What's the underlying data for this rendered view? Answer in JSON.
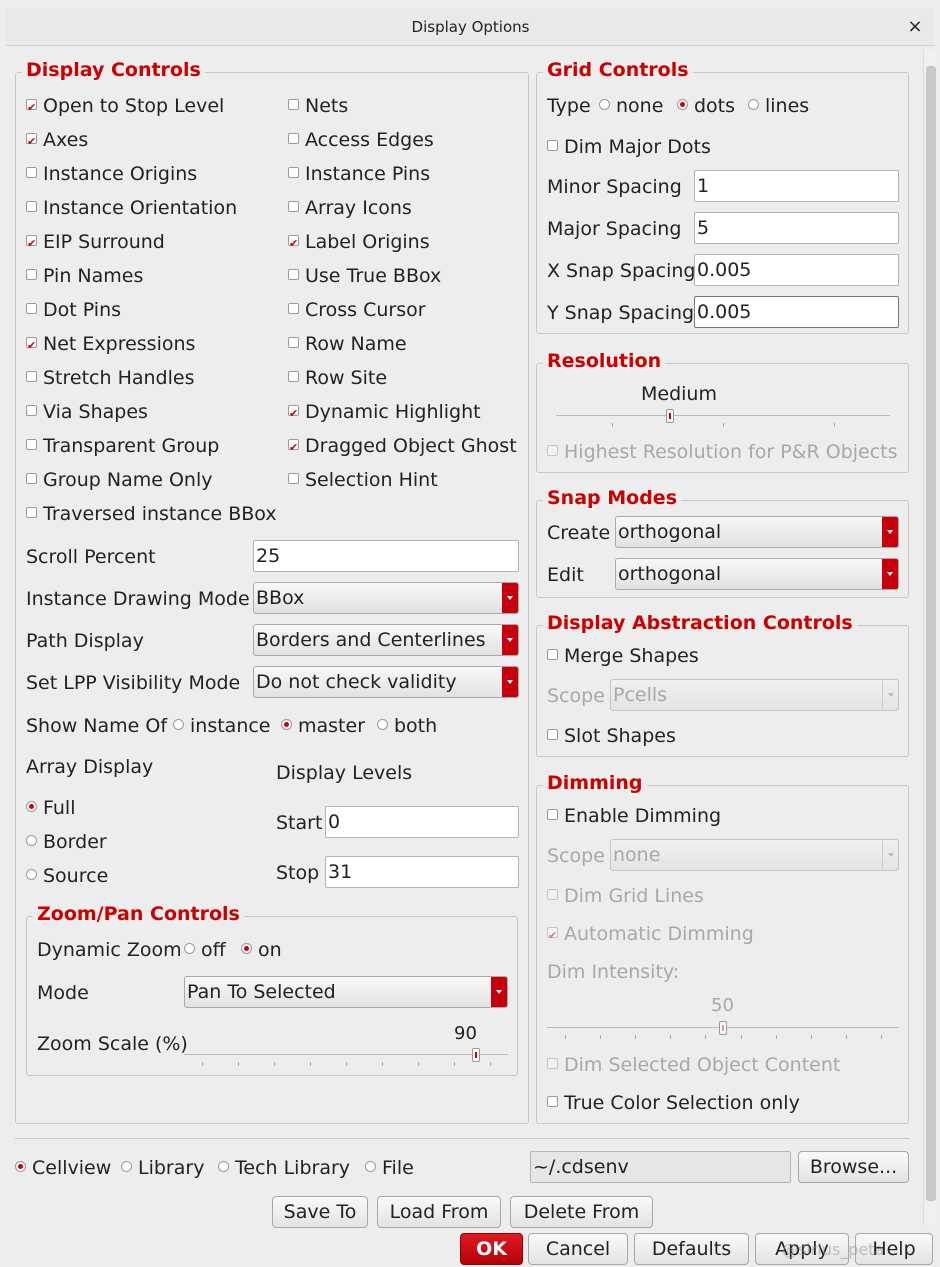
{
  "window": {
    "title": "Display Options",
    "close": "×"
  },
  "display_controls": {
    "title": "Display Controls",
    "left": [
      {
        "label": "Open to Stop Level",
        "checked": true
      },
      {
        "label": "Axes",
        "checked": true
      },
      {
        "label": "Instance Origins",
        "checked": false
      },
      {
        "label": "Instance Orientation",
        "checked": false
      },
      {
        "label": "EIP Surround",
        "checked": true
      },
      {
        "label": "Pin Names",
        "checked": false
      },
      {
        "label": "Dot Pins",
        "checked": false
      },
      {
        "label": "Net Expressions",
        "checked": true
      },
      {
        "label": "Stretch Handles",
        "checked": false
      },
      {
        "label": "Via Shapes",
        "checked": false
      },
      {
        "label": "Transparent Group",
        "checked": false
      },
      {
        "label": "Group Name Only",
        "checked": false
      },
      {
        "label": "Traversed instance BBox",
        "checked": false
      }
    ],
    "right": [
      {
        "label": "Nets",
        "checked": false
      },
      {
        "label": "Access Edges",
        "checked": false
      },
      {
        "label": "Instance Pins",
        "checked": false
      },
      {
        "label": "Array Icons",
        "checked": false
      },
      {
        "label": "Label Origins",
        "checked": true
      },
      {
        "label": "Use True BBox",
        "checked": false
      },
      {
        "label": "Cross Cursor",
        "checked": false
      },
      {
        "label": "Row Name",
        "checked": false
      },
      {
        "label": "Row Site",
        "checked": false
      },
      {
        "label": "Dynamic Highlight",
        "checked": true
      },
      {
        "label": "Dragged Object Ghost",
        "checked": true
      },
      {
        "label": "Selection Hint",
        "checked": false
      }
    ],
    "scroll_percent": {
      "label": "Scroll Percent",
      "value": "25"
    },
    "instance_drawing_mode": {
      "label": "Instance Drawing Mode",
      "value": "BBox"
    },
    "path_display": {
      "label": "Path Display",
      "value": "Borders and Centerlines"
    },
    "lpp_visibility": {
      "label": "Set LPP Visibility Mode",
      "value": "Do not check validity"
    },
    "show_name_of": {
      "label": "Show Name Of",
      "options": [
        "instance",
        "master",
        "both"
      ],
      "selected": "master"
    },
    "array_display": {
      "label": "Array Display",
      "options": [
        "Full",
        "Border",
        "Source"
      ],
      "selected": "Full"
    },
    "display_levels": {
      "label": "Display Levels",
      "start_label": "Start",
      "start": "0",
      "stop_label": "Stop",
      "stop": "31"
    },
    "zoom_pan": {
      "title": "Zoom/Pan Controls",
      "dynamic_zoom_label": "Dynamic Zoom",
      "dynamic_zoom_options": [
        "off",
        "on"
      ],
      "dynamic_zoom_selected": "on",
      "mode_label": "Mode",
      "mode_value": "Pan To Selected",
      "zoom_scale_label": "Zoom Scale (%)",
      "zoom_scale_value": "90",
      "zoom_scale_fraction": 0.9
    }
  },
  "grid_controls": {
    "title": "Grid Controls",
    "type_label": "Type",
    "type_options": [
      "none",
      "dots",
      "lines"
    ],
    "type_selected": "dots",
    "dim_major_dots": {
      "label": "Dim Major Dots",
      "checked": false
    },
    "minor_spacing": {
      "label": "Minor Spacing",
      "value": "1"
    },
    "major_spacing": {
      "label": "Major Spacing",
      "value": "5"
    },
    "x_snap": {
      "label": "X Snap Spacing",
      "value": "0.005"
    },
    "y_snap": {
      "label": "Y Snap Spacing",
      "value": "0.005"
    }
  },
  "resolution": {
    "title": "Resolution",
    "value_label": "Medium",
    "level_fraction": 0.34,
    "highest_res": {
      "label": "Highest Resolution for P&R Objects",
      "checked": false
    }
  },
  "snap_modes": {
    "title": "Snap Modes",
    "create_label": "Create",
    "create_value": "orthogonal",
    "edit_label": "Edit",
    "edit_value": "orthogonal"
  },
  "abstraction": {
    "title": "Display Abstraction Controls",
    "merge_shapes": {
      "label": "Merge Shapes",
      "checked": false
    },
    "scope_label": "Scope",
    "scope_value": "Pcells",
    "slot_shapes": {
      "label": "Slot Shapes",
      "checked": false
    }
  },
  "dimming": {
    "title": "Dimming",
    "enable": {
      "label": "Enable Dimming",
      "checked": false
    },
    "scope_label": "Scope",
    "scope_value": "none",
    "dim_grid_lines": {
      "label": "Dim Grid Lines",
      "checked": false
    },
    "automatic": {
      "label": "Automatic Dimming",
      "checked": true
    },
    "intensity_label": "Dim Intensity:",
    "intensity_value": "50",
    "intensity_fraction": 0.5,
    "dim_selected": {
      "label": "Dim Selected Object Content",
      "checked": false
    },
    "true_color": {
      "label": "True Color Selection only",
      "checked": false
    }
  },
  "footer": {
    "scope_options": [
      "Cellview",
      "Library",
      "Tech Library",
      "File"
    ],
    "scope_selected": "Cellview",
    "file_path": "~/.cdsenv",
    "browse": "Browse...",
    "save_to": "Save To",
    "load_from": "Load From",
    "delete_from": "Delete From",
    "ok": "OK",
    "cancel": "Cancel",
    "defaults": "Defaults",
    "apply": "Apply",
    "help": "Help",
    "watermark": "@sirius_peta"
  }
}
